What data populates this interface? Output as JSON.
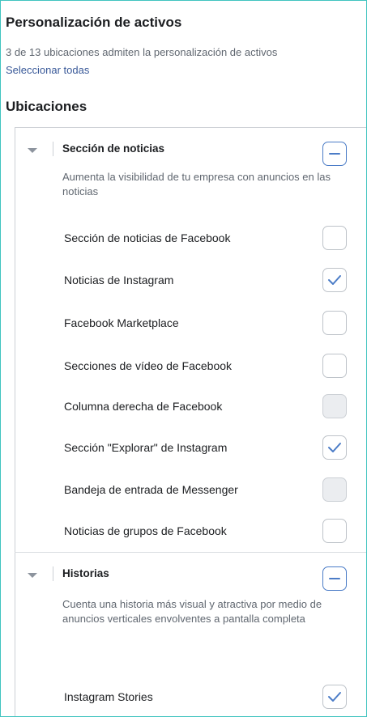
{
  "asset_customization": {
    "title": "Personalización de activos",
    "subtitle": "3 de 13 ubicaciones admiten la personalización de activos",
    "select_all_label": "Seleccionar todas"
  },
  "placements": {
    "heading": "Ubicaciones",
    "groups": [
      {
        "title": "Sección de noticias",
        "description": "Aumenta la visibilidad de tu empresa con anuncios en las noticias",
        "state": "partial",
        "items": [
          {
            "label": "Sección de noticias de Facebook",
            "checked": false,
            "disabled": false
          },
          {
            "label": "Noticias de Instagram",
            "checked": true,
            "disabled": false
          },
          {
            "label": "Facebook Marketplace",
            "checked": false,
            "disabled": false
          },
          {
            "label": "Secciones de vídeo de Facebook",
            "checked": false,
            "disabled": false
          },
          {
            "label": "Columna derecha de Facebook",
            "checked": false,
            "disabled": true
          },
          {
            "label": "Sección \"Explorar\" de Instagram",
            "checked": true,
            "disabled": false
          },
          {
            "label": "Bandeja de entrada de Messenger",
            "checked": false,
            "disabled": true
          },
          {
            "label": "Noticias de grupos de Facebook",
            "checked": false,
            "disabled": false
          }
        ]
      },
      {
        "title": "Historias",
        "description": "Cuenta una historia más visual y atractiva por medio de anuncios verticales envolventes a pantalla completa",
        "state": "partial",
        "items": [
          {
            "label": "Instagram Stories",
            "checked": true,
            "disabled": false
          }
        ]
      }
    ]
  },
  "colors": {
    "accent": "#4b7cc7",
    "link": "#385898",
    "frame": "#40c4c0",
    "disabled_fill": "#ebedf0"
  },
  "icons": {
    "collapse": "caret-down-icon",
    "checked": "checkmark-icon",
    "partial": "minus-icon"
  }
}
